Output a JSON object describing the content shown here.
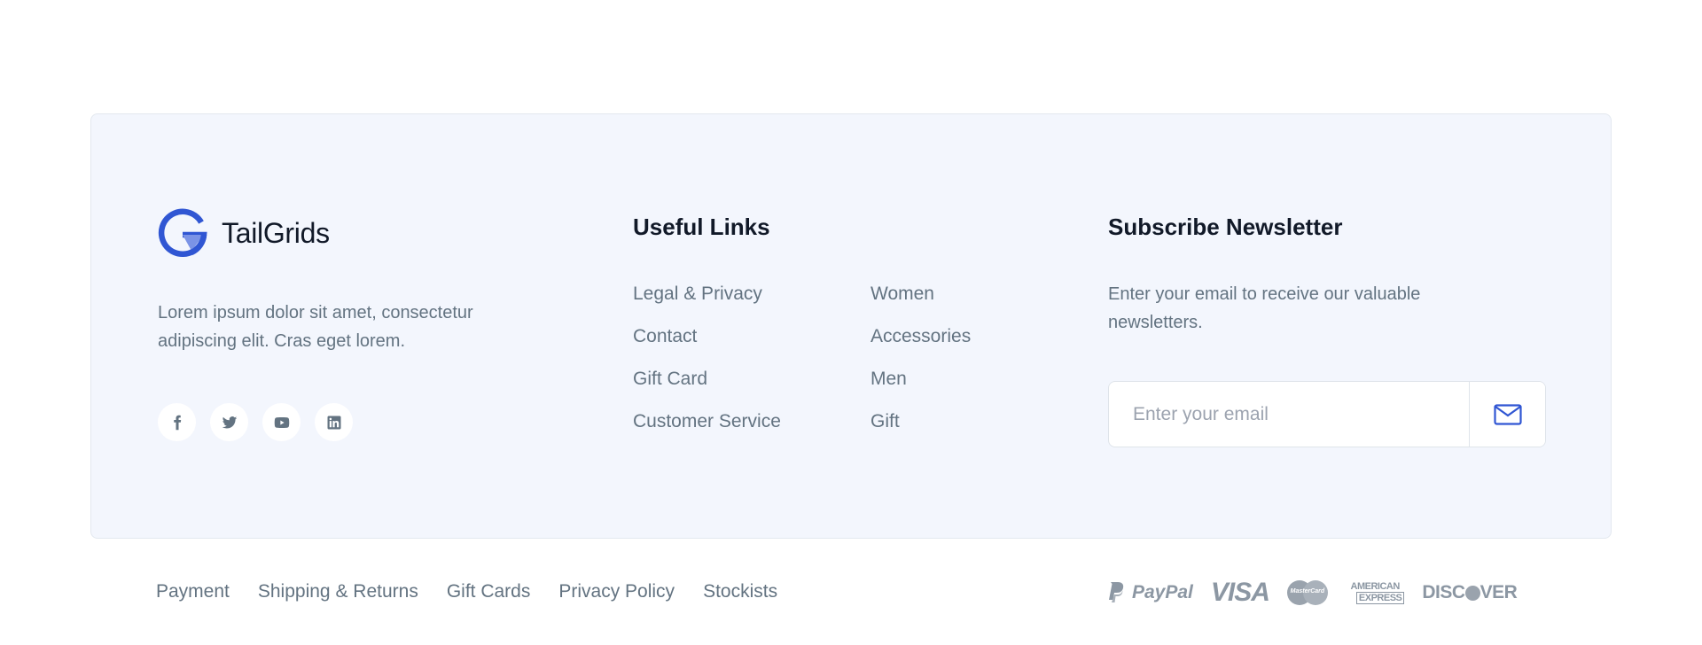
{
  "brand": {
    "name": "TailGrids",
    "logo_icon": "tailgrids-logo-icon",
    "description": "Lorem ipsum dolor sit amet, consectetur adipiscing elit. Cras eget lorem.",
    "accent_color": "#3056D3"
  },
  "socials": [
    {
      "name": "facebook",
      "icon": "facebook-icon"
    },
    {
      "name": "twitter",
      "icon": "twitter-icon"
    },
    {
      "name": "youtube",
      "icon": "youtube-icon"
    },
    {
      "name": "linkedin",
      "icon": "linkedin-icon"
    }
  ],
  "useful_links": {
    "title": "Useful Links",
    "column1": [
      "Legal & Privacy",
      "Contact",
      "Gift Card",
      "Customer Service"
    ],
    "column2": [
      "Women",
      "Accessories",
      "Men",
      "Gift"
    ]
  },
  "newsletter": {
    "title": "Subscribe Newsletter",
    "description": "Enter your email to receive our valuable newsletters.",
    "email_placeholder": "Enter your email",
    "email_value": "",
    "submit_icon": "mail-icon"
  },
  "bottom_links": [
    "Payment",
    "Shipping & Returns",
    "Gift Cards",
    "Privacy Policy",
    "Stockists"
  ],
  "payment_methods": {
    "paypal": "PayPal",
    "visa": "VISA",
    "mastercard": "MasterCard",
    "amex_line1": "AMERICAN",
    "amex_line2": "EXPRESS",
    "discover_pre": "DISC",
    "discover_post": "VER"
  }
}
